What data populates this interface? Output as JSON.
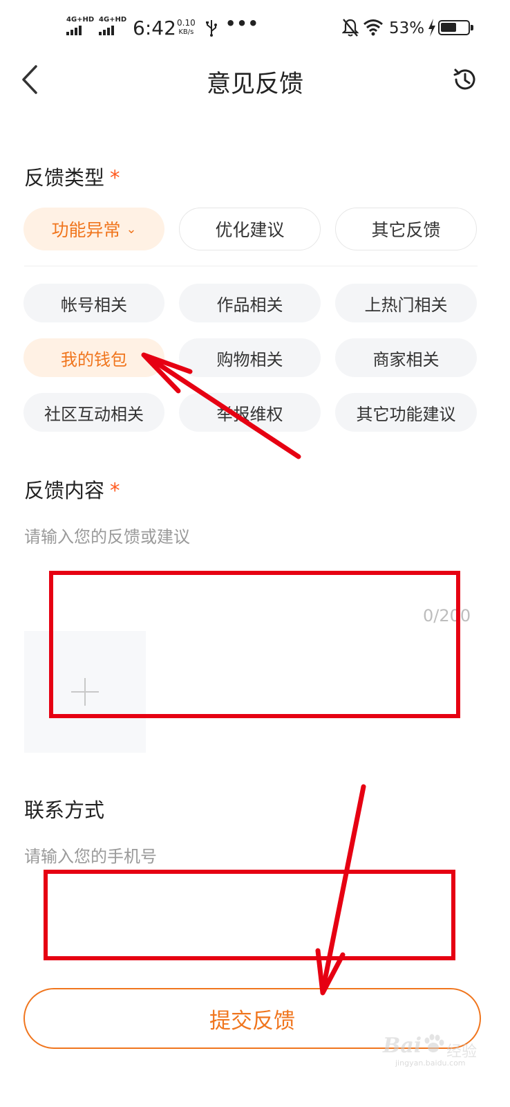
{
  "status_bar": {
    "signal1": "4G+HD",
    "signal2": "4G+HD",
    "time": "6:42",
    "speed_value": "0.10",
    "speed_unit": "KB/s",
    "more": "•••",
    "battery_percent": "53%",
    "battery_level": 0.53,
    "icons": [
      "usb-icon",
      "bell-off-icon",
      "wifi-icon",
      "charging-icon",
      "battery-icon"
    ]
  },
  "nav": {
    "back_icon": "chevron-left-icon",
    "title": "意见反馈",
    "history_icon": "clock-history-icon"
  },
  "feedback_type": {
    "label": "反馈类型",
    "required_mark": "*",
    "categories": [
      "功能异常",
      "优化建议",
      "其它反馈"
    ],
    "active_category": "功能异常",
    "subtypes": [
      "帐号相关",
      "作品相关",
      "上热门相关",
      "我的钱包",
      "购物相关",
      "商家相关",
      "社区互动相关",
      "举报维权",
      "其它功能建议"
    ],
    "active_subtype": "我的钱包"
  },
  "feedback_content": {
    "label": "反馈内容",
    "required_mark": "*",
    "placeholder": "请输入您的反馈或建议",
    "counter": "0/200",
    "upload_icon": "plus-icon"
  },
  "contact": {
    "label": "联系方式",
    "placeholder": "请输入您的手机号"
  },
  "submit_label": "提交反馈",
  "watermark": {
    "brand": "Bai",
    "brand_cn": "经验",
    "url": "jingyan.baidu.com"
  },
  "colors": {
    "accent": "#f0751d",
    "accent_bg": "#fff1e4",
    "annotation_red": "#e60012",
    "chip_bg": "#f4f5f7"
  }
}
